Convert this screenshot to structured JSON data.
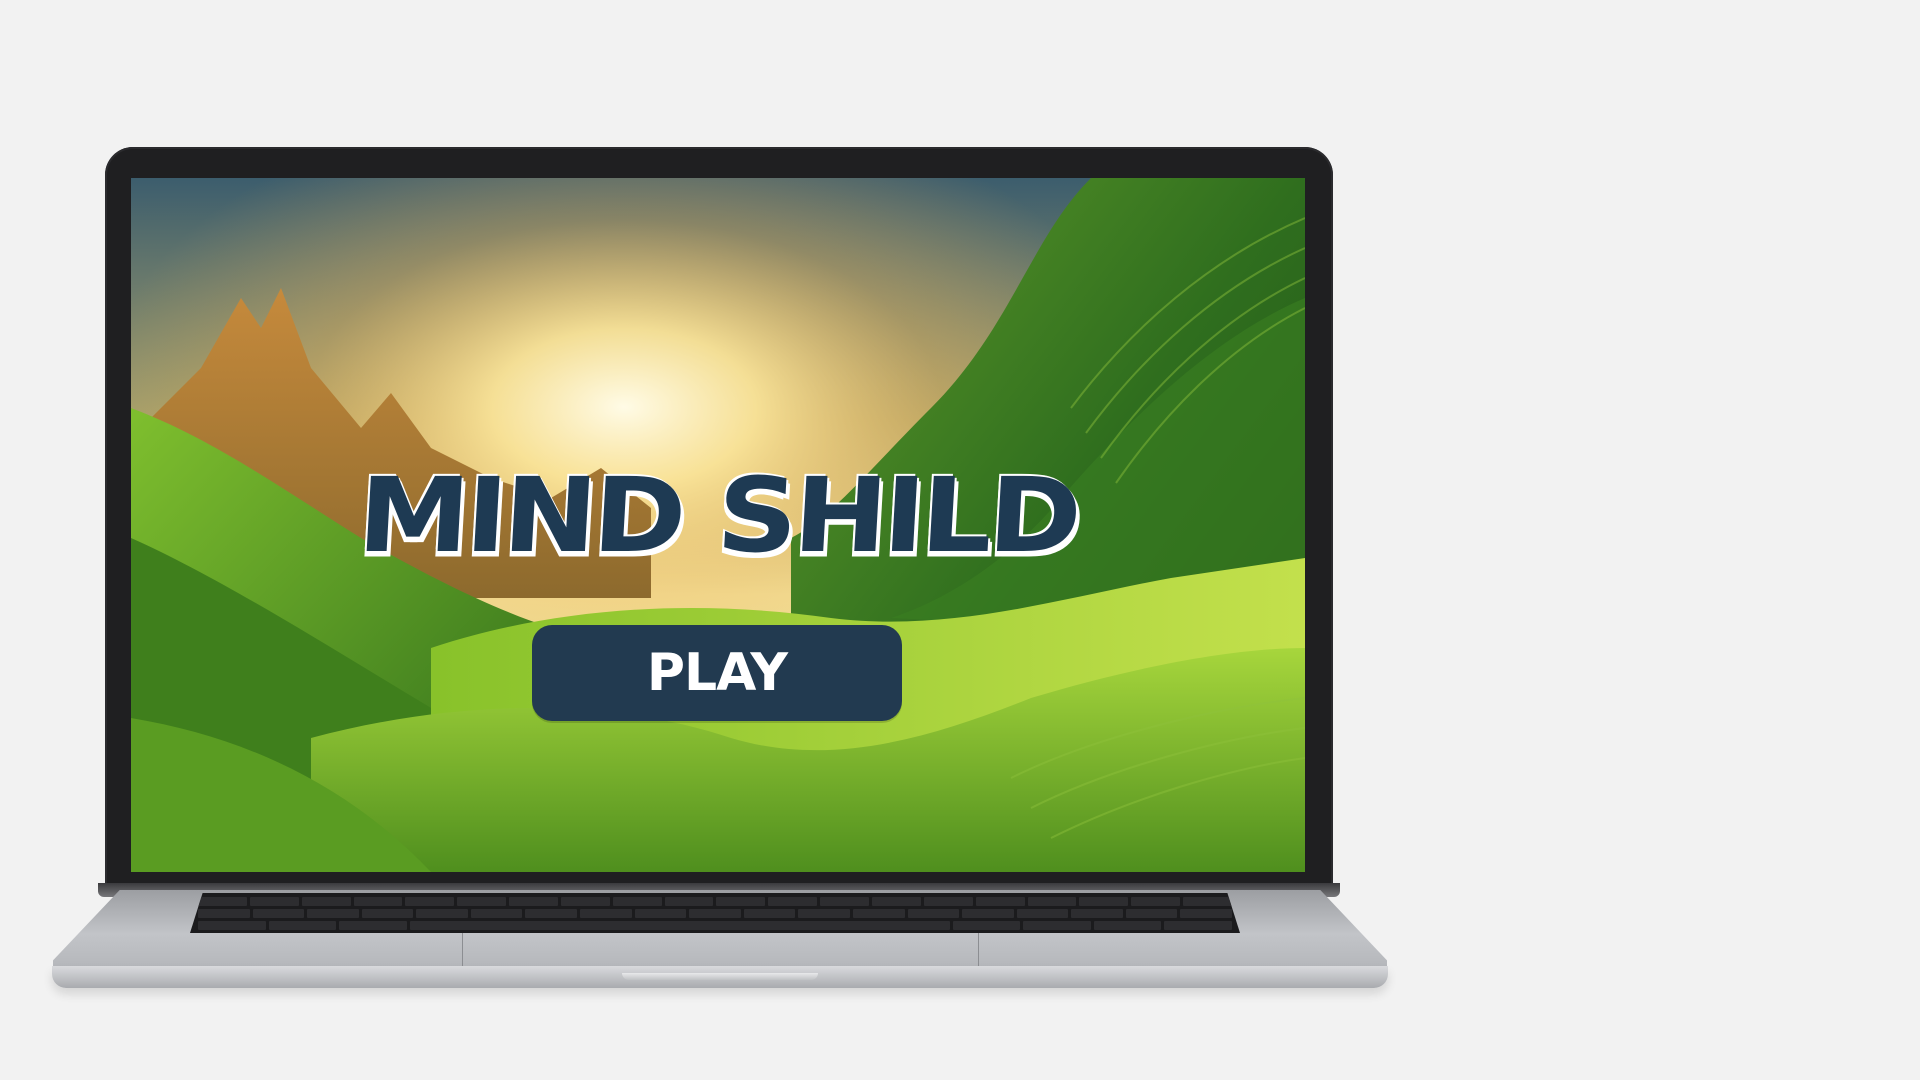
{
  "game": {
    "title": "MIND SHILD",
    "play_label": "PLAY"
  },
  "colors": {
    "title_fill": "#1e3a53",
    "title_outline": "#ffffff",
    "button_fill": "#223a50",
    "button_text": "#ffffff",
    "background": "#f2f2f2"
  }
}
